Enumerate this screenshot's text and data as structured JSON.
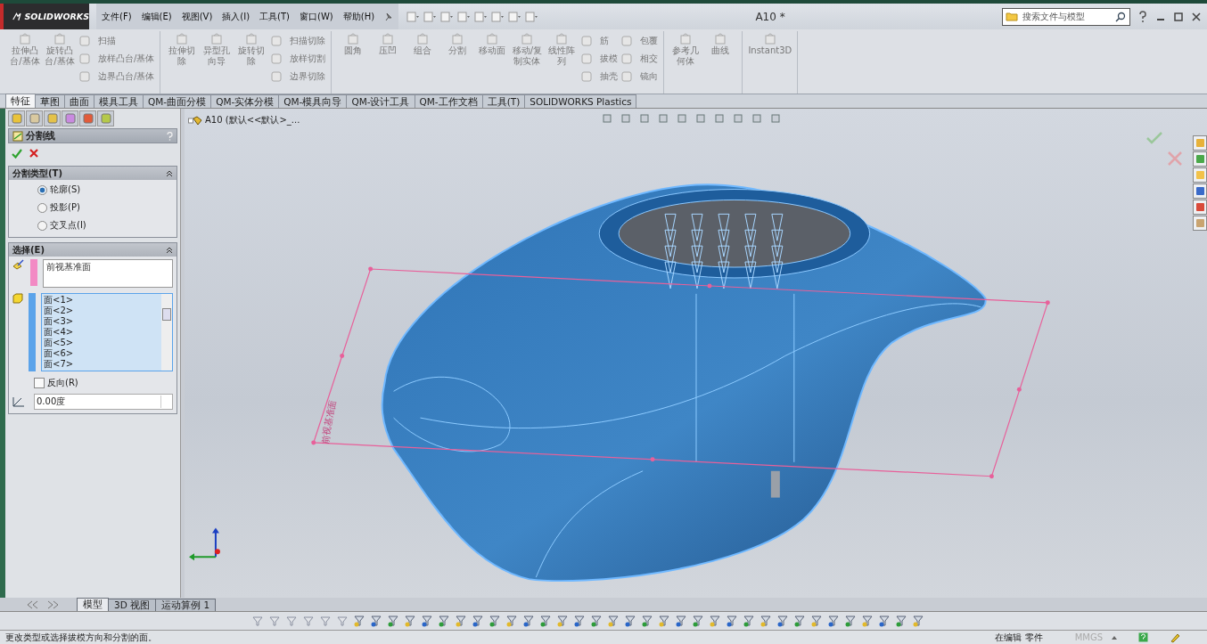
{
  "app": {
    "logo": "SOLIDWORKS",
    "menu": [
      "文件(F)",
      "编辑(E)",
      "视图(V)",
      "插入(I)",
      "工具(T)",
      "窗口(W)",
      "帮助(H)"
    ],
    "document_title": "A10 *",
    "search": {
      "placeholder": "搜索文件与模型"
    }
  },
  "ribbon": {
    "groups": [
      {
        "items": [
          {
            "kind": "large",
            "label": "拉伸凸台/基体"
          },
          {
            "kind": "large",
            "label": "旋转凸台/基体"
          },
          {
            "kind": "column",
            "labels": [
              "扫描",
              "放样凸台/基体",
              "边界凸台/基体"
            ]
          }
        ]
      },
      {
        "items": [
          {
            "kind": "large",
            "label": "拉伸切除"
          },
          {
            "kind": "large",
            "label": "异型孔向导"
          },
          {
            "kind": "large",
            "label": "旋转切除"
          },
          {
            "kind": "column",
            "labels": [
              "扫描切除",
              "放样切割",
              "边界切除"
            ]
          }
        ]
      },
      {
        "items": [
          {
            "kind": "large",
            "label": "圆角"
          },
          {
            "kind": "large",
            "label": "压凹"
          },
          {
            "kind": "large",
            "label": "组合"
          },
          {
            "kind": "large",
            "label": "分割"
          },
          {
            "kind": "large",
            "label": "移动面"
          },
          {
            "kind": "large",
            "label": "移动/复制实体"
          },
          {
            "kind": "large",
            "label": "线性阵列"
          },
          {
            "kind": "column",
            "labels": [
              "筋",
              "拔模",
              "抽壳"
            ]
          },
          {
            "kind": "column",
            "labels": [
              "包覆",
              "相交",
              "镜向"
            ]
          }
        ]
      },
      {
        "items": [
          {
            "kind": "large",
            "label": "参考几何体"
          },
          {
            "kind": "large",
            "label": "曲线"
          }
        ]
      },
      {
        "items": [
          {
            "kind": "large",
            "label": "Instant3D"
          }
        ]
      }
    ]
  },
  "command_tabs": [
    {
      "label": "特征",
      "selected": true
    },
    {
      "label": "草图",
      "selected": false
    },
    {
      "label": "曲面",
      "selected": false
    },
    {
      "label": "模具工具",
      "selected": false
    },
    {
      "label": "QM-曲面分模",
      "selected": false
    },
    {
      "label": "QM-实体分模",
      "selected": false
    },
    {
      "label": "QM-模具向导",
      "selected": false
    },
    {
      "label": "QM-设计工具",
      "selected": false
    },
    {
      "label": "QM-工作文档",
      "selected": false
    },
    {
      "label": "工具(T)",
      "selected": false
    },
    {
      "label": "SOLIDWORKS Plastics",
      "selected": false
    }
  ],
  "property_manager": {
    "title": "分割线",
    "sections": [
      {
        "kind": "radios",
        "title": "分割类型(T)",
        "options": [
          {
            "label": "轮廓(S)",
            "selected": true
          },
          {
            "label": "投影(P)",
            "selected": false
          },
          {
            "label": "交叉点(I)",
            "selected": false
          }
        ]
      },
      {
        "kind": "selection",
        "title": "选择(E)",
        "plane": "前视基准面",
        "faces": [
          "面<1>",
          "面<2>",
          "面<3>",
          "面<4>",
          "面<5>",
          "面<6>",
          "面<7>"
        ],
        "reverse": {
          "label": "反向(R)",
          "checked": false
        },
        "angle": "0.00度"
      }
    ]
  },
  "viewport": {
    "tree_root": "A10  (默认<<默认>_...",
    "plane_label": "前视基准面"
  },
  "bottom_tabs": [
    {
      "label": "模型",
      "selected": true
    },
    {
      "label": "3D 视图",
      "selected": false
    },
    {
      "label": "运动算例 1",
      "selected": false
    }
  ],
  "status_bar": {
    "message": "更改类型或选择拔模方向和分割的面。",
    "mode": "在编辑 零件",
    "units": "MMGS"
  }
}
